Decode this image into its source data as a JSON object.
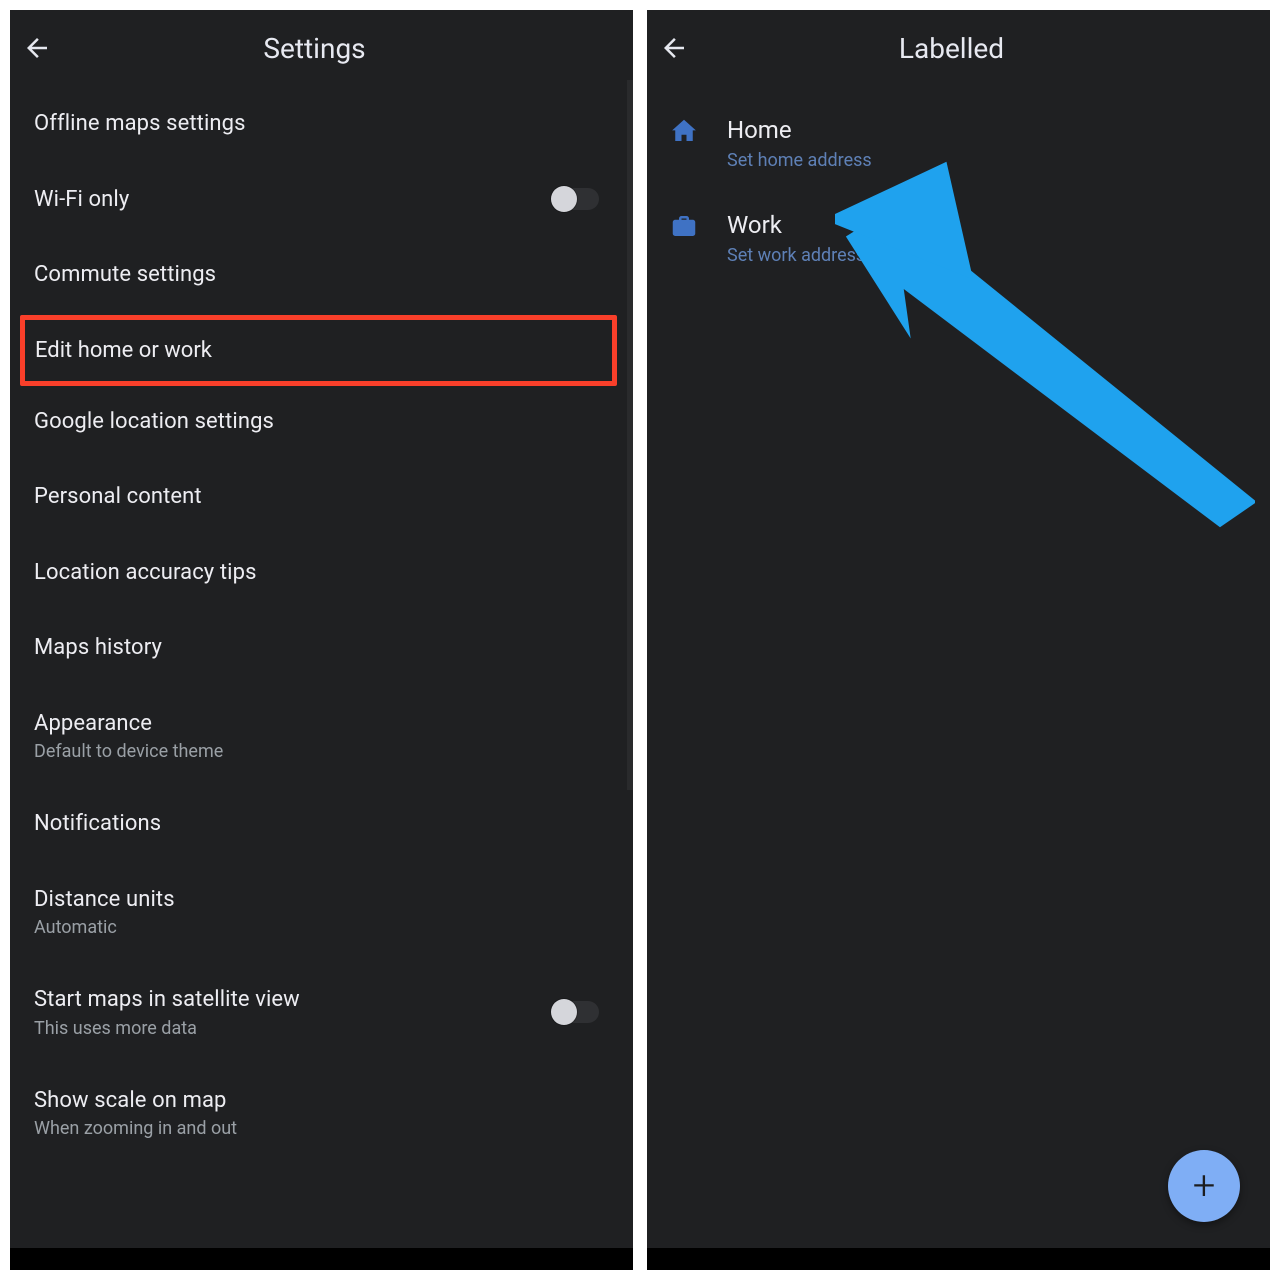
{
  "colors": {
    "accent_blue": "#7faef5",
    "link_blue": "#5e80b6",
    "highlight_red": "#f93f2a"
  },
  "left_phone": {
    "title": "Settings",
    "highlighted_item_index": 3,
    "items": [
      {
        "primary": "Offline maps settings"
      },
      {
        "primary": "Wi-Fi only",
        "toggle": true,
        "toggle_on": false
      },
      {
        "primary": "Commute settings"
      },
      {
        "primary": "Edit home or work"
      },
      {
        "primary": "Google location settings"
      },
      {
        "primary": "Personal content"
      },
      {
        "primary": "Location accuracy tips"
      },
      {
        "primary": "Maps history"
      },
      {
        "primary": "Appearance",
        "secondary": "Default to device theme"
      },
      {
        "primary": "Notifications"
      },
      {
        "primary": "Distance units",
        "secondary": "Automatic"
      },
      {
        "primary": "Start maps in satellite view",
        "secondary": "This uses more data",
        "toggle": true,
        "toggle_on": false
      },
      {
        "primary": "Show scale on map",
        "secondary": "When zooming in and out"
      }
    ]
  },
  "right_phone": {
    "title": "Labelled",
    "rows": [
      {
        "icon": "home-icon",
        "primary": "Home",
        "secondary": "Set home address"
      },
      {
        "icon": "briefcase-icon",
        "primary": "Work",
        "secondary": "Set work address"
      }
    ],
    "fab_glyph": "+"
  }
}
